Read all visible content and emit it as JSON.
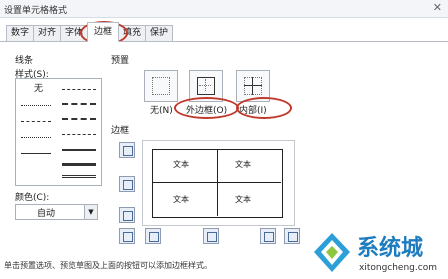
{
  "window": {
    "title": "设置单元格格式",
    "close_glyph": "✕"
  },
  "tabs": [
    "数字",
    "对齐",
    "字体",
    "边框",
    "填充",
    "保护"
  ],
  "active_tab": "边框",
  "line_group": {
    "label": "线条",
    "style_label": "样式(S):",
    "none_label": "无"
  },
  "color": {
    "label": "颜色(C):",
    "value": "自动"
  },
  "presets": {
    "label": "预置",
    "none": "无(N)",
    "outline": "外边框(O)",
    "inside": "内部(I)"
  },
  "border": {
    "label": "边框"
  },
  "preview": {
    "cells": [
      "文本",
      "文本",
      "文本",
      "文本"
    ]
  },
  "footer": "单击预置选项、预览草图及上面的按钮可以添加边框样式。",
  "watermark": {
    "brand": "系统城",
    "url": "xitongcheng.com",
    "brand_color": "#1d7bbf"
  },
  "highlight_color": "#c0392b"
}
